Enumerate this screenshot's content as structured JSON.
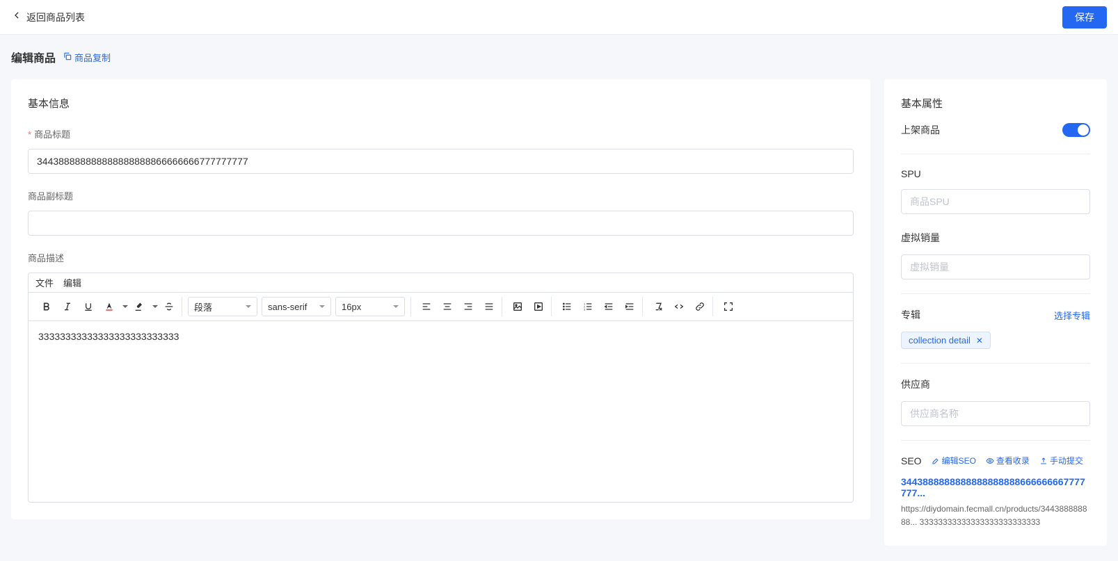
{
  "topbar": {
    "back_label": "返回商品列表",
    "save_label": "保存"
  },
  "page": {
    "title": "编辑商品",
    "copy_label": "商品复制"
  },
  "main": {
    "section_title": "基本信息",
    "title_label": "商品标题",
    "title_value": "344388888888888888888866666666777777777",
    "subtitle_label": "商品副标题",
    "subtitle_value": "",
    "desc_label": "商品描述",
    "editor": {
      "menu_file": "文件",
      "menu_edit": "编辑",
      "paragraph_label": "段落",
      "font_family": "sans-serif",
      "font_size": "16px",
      "content": "33333333333333333333333333"
    }
  },
  "side": {
    "attr_title": "基本属性",
    "publish_label": "上架商品",
    "spu_label": "SPU",
    "spu_placeholder": "商品SPU",
    "spu_value": "",
    "virtual_sales_label": "虚拟销量",
    "virtual_sales_placeholder": "虚拟销量",
    "virtual_sales_value": "",
    "collection_label": "专辑",
    "collection_select_label": "选择专辑",
    "collection_tag": "collection detail",
    "supplier_label": "供应商",
    "supplier_placeholder": "供应商名称",
    "supplier_value": "",
    "seo_title": "SEO",
    "seo_edit_label": "编辑SEO",
    "seo_view_label": "查看收录",
    "seo_submit_label": "手动提交",
    "seo_product_title": "3443888888888888888888666666667777777...",
    "seo_url": "https://diydomain.fecmall.cn/products/344388888888... 33333333333333333333333333"
  }
}
